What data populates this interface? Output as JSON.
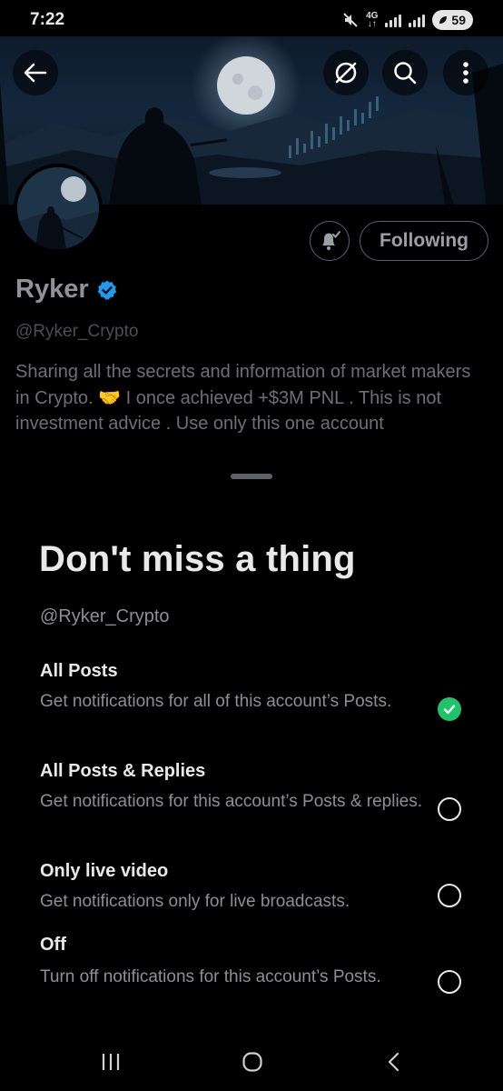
{
  "status_bar": {
    "time": "7:22",
    "network": "4G",
    "battery": "59"
  },
  "header": {
    "back_icon": "arrow-left-icon",
    "icons": [
      "no-crypto-icon",
      "search-icon",
      "more-vertical-icon"
    ]
  },
  "profile": {
    "name": "Ryker",
    "handle": "@Ryker_Crypto",
    "bio": "Sharing all the secrets and information of market makers in Crypto. 🤝 I once achieved +$3M PNL . This is not investment advice . Use only this one account",
    "following_label": "Following",
    "verified_color": "#1d9bf0"
  },
  "sheet": {
    "title": "Don't miss a thing",
    "handle": "@Ryker_Crypto",
    "options": [
      {
        "title": "All Posts",
        "description": "Get notifications for all of this account’s Posts.",
        "selected": true
      },
      {
        "title": "All Posts & Replies",
        "description": "Get notifications for this account’s Posts & replies.",
        "selected": false
      },
      {
        "title": "Only live video",
        "description": "Get notifications only for live broadcasts.",
        "selected": false
      },
      {
        "title": "Off",
        "description": "Turn off notifications for this account’s Posts.",
        "selected": false
      }
    ],
    "selected_color": "#1fc46a"
  },
  "navbar": {
    "icons": [
      "recents-icon",
      "home-icon",
      "back-icon"
    ]
  }
}
